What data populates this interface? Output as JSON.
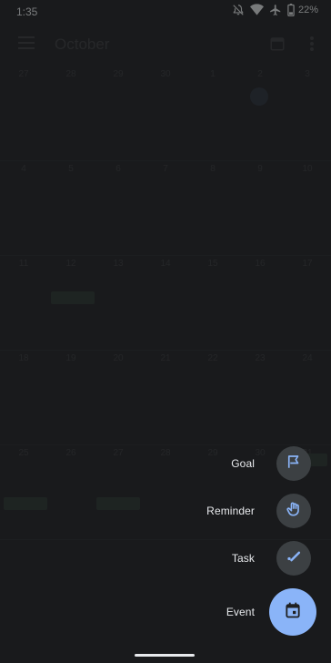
{
  "status_bar": {
    "time": "1:35",
    "battery": "22%"
  },
  "app_bar": {
    "month": "October"
  },
  "calendar": {
    "header_days": [
      "S",
      "M",
      "T",
      "W",
      "T",
      "F",
      "S"
    ],
    "weeks": [
      [
        "27",
        "28",
        "29",
        "30",
        "1",
        "2",
        "3"
      ],
      [
        "4",
        "5",
        "6",
        "7",
        "8",
        "9",
        "10"
      ],
      [
        "11",
        "12",
        "13",
        "14",
        "15",
        "16",
        "17"
      ],
      [
        "18",
        "19",
        "20",
        "21",
        "22",
        "23",
        "24"
      ],
      [
        "25",
        "26",
        "27",
        "28",
        "29",
        "30",
        "31"
      ]
    ]
  },
  "speed_dial": {
    "goal_label": "Goal",
    "reminder_label": "Reminder",
    "task_label": "Task",
    "event_label": "Event"
  },
  "colors": {
    "accent": "#8ab4f8",
    "background": "#1f2022",
    "mini_fab": "#3c4043"
  }
}
